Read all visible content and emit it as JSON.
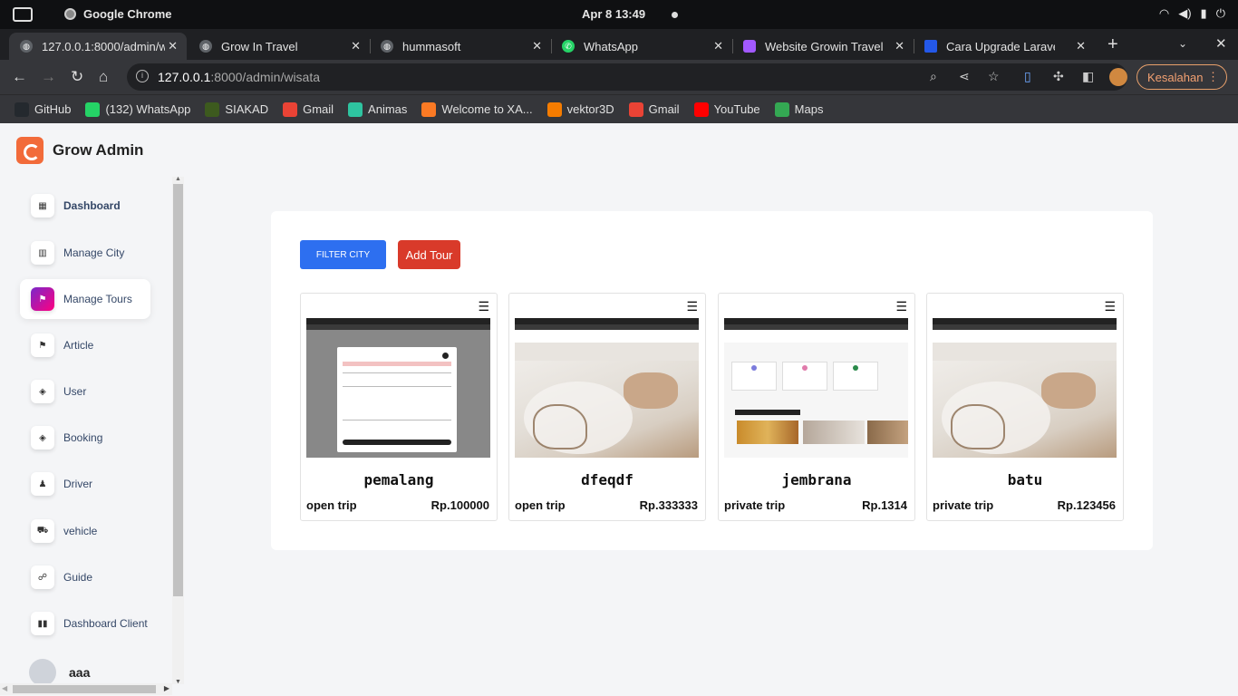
{
  "os": {
    "app_name": "Google Chrome",
    "clock": "Apr 8  13:49"
  },
  "tabs": [
    {
      "title": "127.0.0.1:8000/admin/wisata",
      "favicon": "globe-icon",
      "active": true
    },
    {
      "title": "Grow In Travel",
      "favicon": "globe-icon"
    },
    {
      "title": "hummasoft",
      "favicon": "globe-icon"
    },
    {
      "title": "WhatsApp",
      "favicon": "whatsapp-icon"
    },
    {
      "title": "Website Growin Travel",
      "favicon": "figma-icon"
    },
    {
      "title": "Cara Upgrade Laravel",
      "favicon": "bookmark-icon"
    }
  ],
  "toolbar": {
    "url_host": "127.0.0.1",
    "url_path": ":8000/admin/wisata",
    "profile_button": "Kesalahan"
  },
  "bookmarks": [
    {
      "label": "GitHub",
      "icon": "github-icon",
      "color": "#24292e"
    },
    {
      "label": "(132) WhatsApp",
      "icon": "whatsapp-icon",
      "color": "#25d366"
    },
    {
      "label": "SIAKAD",
      "icon": "siakad-icon",
      "color": "#3d5a1e"
    },
    {
      "label": "Gmail",
      "icon": "gmail-icon",
      "color": "#ea4335"
    },
    {
      "label": "Animas",
      "icon": "animas-icon",
      "color": "#2ec4a0"
    },
    {
      "label": "Welcome to XA...",
      "icon": "xampp-icon",
      "color": "#fb7a24"
    },
    {
      "label": "vektor3D",
      "icon": "vektor-icon",
      "color": "#f57c00"
    },
    {
      "label": "Gmail",
      "icon": "gmail-icon",
      "color": "#ea4335"
    },
    {
      "label": "YouTube",
      "icon": "youtube-icon",
      "color": "#ff0000"
    },
    {
      "label": "Maps",
      "icon": "maps-icon",
      "color": "#34a853"
    }
  ],
  "brand": {
    "name": "Grow Admin"
  },
  "sidebar": {
    "items": [
      {
        "label": "Dashboard",
        "icon": "shop-icon",
        "glyph": "▦"
      },
      {
        "label": "Manage City",
        "icon": "building-icon",
        "glyph": "▥"
      },
      {
        "label": "Manage Tours",
        "icon": "tour-icon",
        "glyph": "⚑",
        "active": true
      },
      {
        "label": "Article",
        "icon": "article-icon",
        "glyph": "⚑"
      },
      {
        "label": "User",
        "icon": "tag-icon",
        "glyph": "◈"
      },
      {
        "label": "Booking",
        "icon": "tag-icon",
        "glyph": "◈"
      },
      {
        "label": "Driver",
        "icon": "person-icon",
        "glyph": "♟"
      },
      {
        "label": "vehicle",
        "icon": "car-icon",
        "glyph": "⛟"
      },
      {
        "label": "Guide",
        "icon": "guide-icon",
        "glyph": "☍"
      },
      {
        "label": "Dashboard Client",
        "icon": "grid-icon",
        "glyph": "▮▮"
      }
    ]
  },
  "user": {
    "name": "aaa"
  },
  "main": {
    "filter_button": "FILTER CITY",
    "add_button": "Add Tour",
    "colors": {
      "filter": "#2d6ff0",
      "add": "#d93a2a"
    },
    "tours": [
      {
        "name": "pemalang",
        "type": "open trip",
        "price": "Rp.100000",
        "thumbnail": "modal-screenshot"
      },
      {
        "name": "dfeqdf",
        "type": "open trip",
        "price": "Rp.333333",
        "thumbnail": "batik-photo"
      },
      {
        "name": "jembrana",
        "type": "private trip",
        "price": "Rp.1314",
        "thumbnail": "dashboard-screenshot"
      },
      {
        "name": "batu",
        "type": "private trip",
        "price": "Rp.123456",
        "thumbnail": "batik-photo"
      }
    ]
  }
}
